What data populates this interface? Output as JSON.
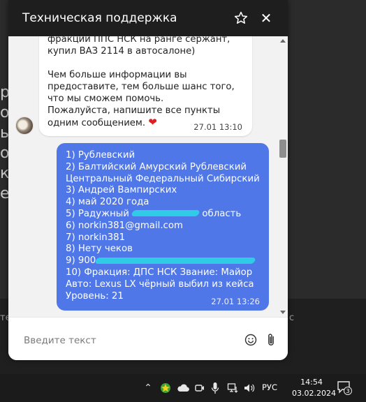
{
  "background": {
    "letters": [
      "р",
      "о",
      "ы",
      "о",
      "к",
      "е"
    ],
    "bottom_left": "те",
    "bottom_right": "с"
  },
  "widget": {
    "title": "Техническая поддержка",
    "star_icon": "star-outline-icon",
    "close_label": "✕"
  },
  "messages": {
    "incoming": {
      "text": "фракции ППС НСК на ранге сержант, купил ВАЗ 2114 в автосалоне)\n\nЧем больше информации вы предоставите, тем больше шанс того, что мы сможем помочь.\nПожалуйста, напишите все пункты одним сообщением.",
      "emoji": "❤",
      "time": "27.01 13:10"
    },
    "outgoing": {
      "lines": [
        "1) Рублевский",
        "2) Балтийский Амурский Рублевский",
        "Центральный Федеральный Сибирский",
        "3) Андрей Вампирских",
        "4) май 2020 года",
        "5) Радужный",
        "область",
        "6) norkin381@gmail.com",
        "7) norkin381",
        "8) Нету чеков",
        "9) 900",
        "10) Фракция: ДПС НСК Звание: Майор",
        "Авто: Lexus LX чёрный выбил из кейса",
        "Уровень: 21"
      ],
      "time": "27.01 13:26"
    }
  },
  "input": {
    "placeholder": "Введите текст"
  },
  "taskbar": {
    "language": "РУС",
    "time": "14:54",
    "date": "03.02.2024",
    "notification_count": "3"
  },
  "colors": {
    "header_bg": "#1e1e1e",
    "outgoing_bubble": "#4f77e8",
    "scribble": "#2ed0e6",
    "heart": "#e02020"
  }
}
